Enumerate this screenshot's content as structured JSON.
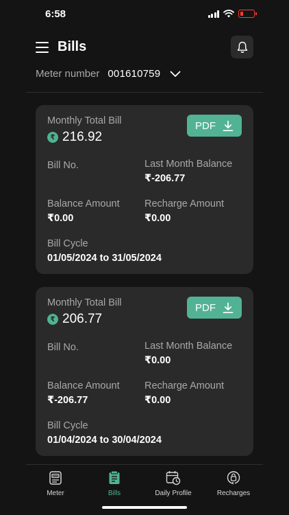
{
  "status_bar": {
    "time": "6:58"
  },
  "header": {
    "title": "Bills"
  },
  "meter": {
    "label": "Meter number",
    "value": "001610759"
  },
  "bills": [
    {
      "total_label": "Monthly Total Bill",
      "currency_symbol": "₹",
      "total_amount": "216.92",
      "pdf_label": "PDF",
      "bill_no_label": "Bill No.",
      "last_month_balance_label": "Last Month Balance",
      "last_month_balance": "₹-206.77",
      "balance_amount_label": "Balance Amount",
      "balance_amount": "₹0.00",
      "recharge_amount_label": "Recharge Amount",
      "recharge_amount": "₹0.00",
      "bill_cycle_label": "Bill Cycle",
      "bill_cycle": "01/05/2024 to 31/05/2024"
    },
    {
      "total_label": "Monthly Total Bill",
      "currency_symbol": "₹",
      "total_amount": "206.77",
      "pdf_label": "PDF",
      "bill_no_label": "Bill No.",
      "last_month_balance_label": "Last Month Balance",
      "last_month_balance": "₹0.00",
      "balance_amount_label": "Balance Amount",
      "balance_amount": "₹-206.77",
      "recharge_amount_label": "Recharge Amount",
      "recharge_amount": "₹0.00",
      "bill_cycle_label": "Bill Cycle",
      "bill_cycle": "01/04/2024 to 30/04/2024"
    }
  ],
  "nav": {
    "items": [
      {
        "label": "Meter",
        "icon": "meter-icon"
      },
      {
        "label": "Bills",
        "icon": "bills-icon",
        "active": true
      },
      {
        "label": "Daily Profile",
        "icon": "calendar-clock-icon"
      },
      {
        "label": "Recharges",
        "icon": "recharge-icon"
      }
    ]
  },
  "colors": {
    "accent": "#52b394",
    "background": "#141414",
    "card": "#2a2a2a",
    "muted_text": "#a9a9a9"
  }
}
